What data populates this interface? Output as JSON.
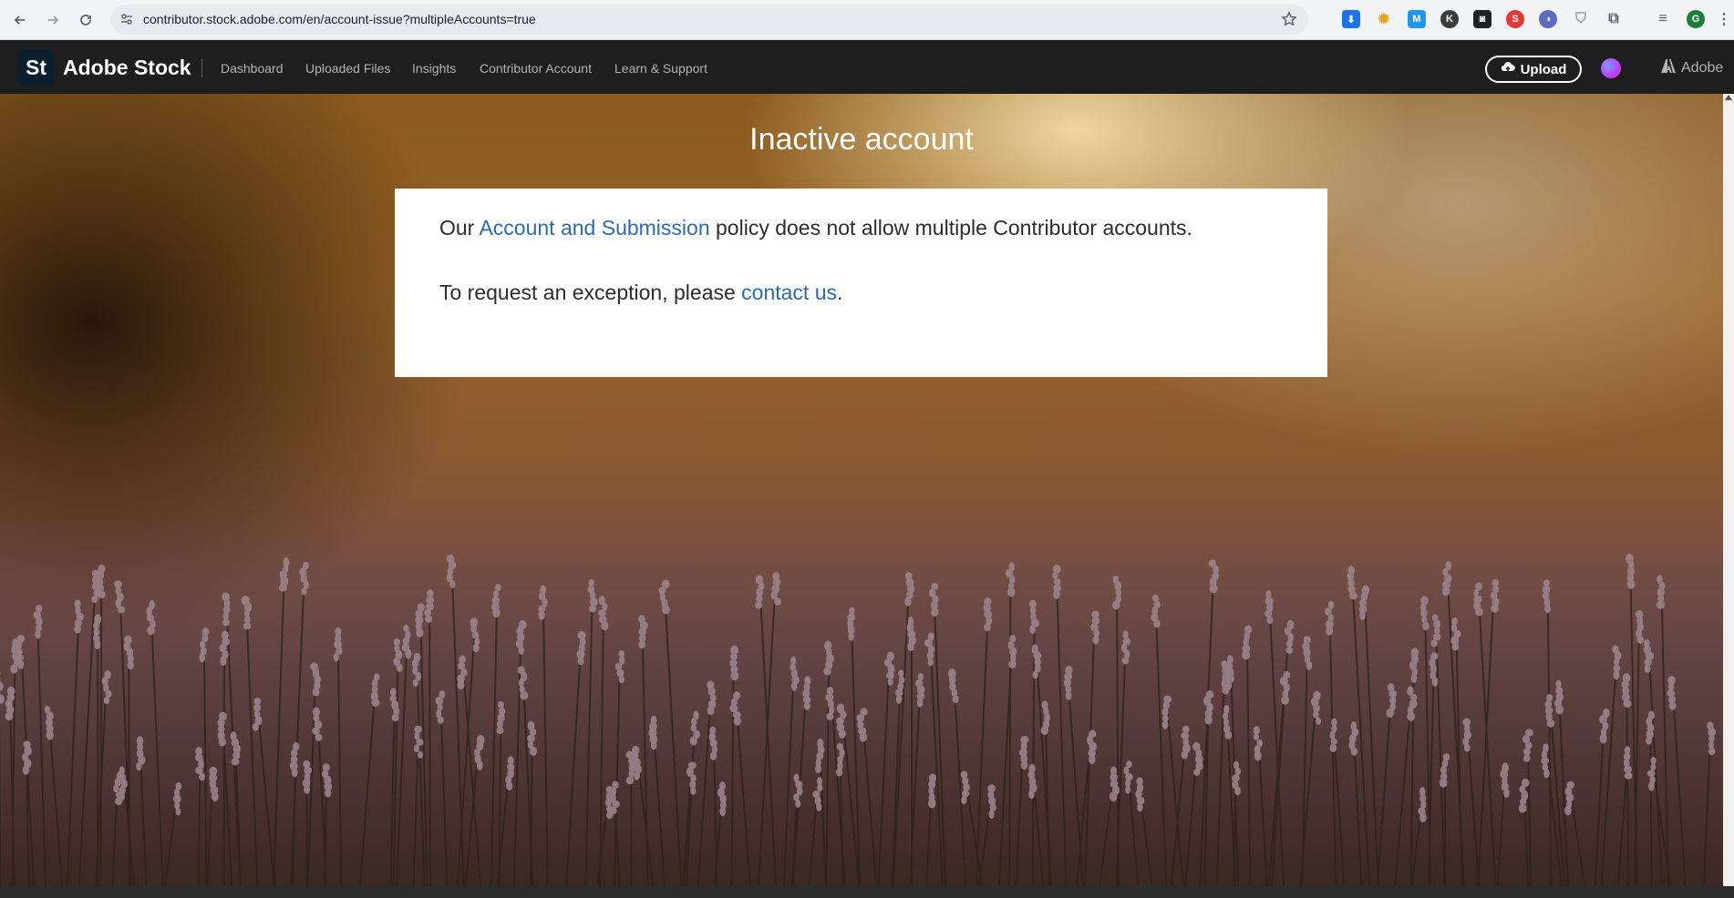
{
  "browser": {
    "url": "contributor.stock.adobe.com/en/account-issue?multipleAccounts=true",
    "profile_initial": "G"
  },
  "header": {
    "logo_text": "St",
    "brand": "Adobe Stock",
    "nav": [
      "Dashboard",
      "Uploaded Files",
      "Insights",
      "Contributor Account",
      "Learn & Support"
    ],
    "upload_label": "Upload",
    "adobe_label": "Adobe"
  },
  "main": {
    "title": "Inactive account",
    "line1": {
      "prefix": "Our ",
      "link": "Account and Submission",
      "suffix": " policy does not allow multiple Contributor accounts."
    },
    "line2": {
      "prefix": "To request an exception, please ",
      "link": "contact us",
      "suffix": "."
    }
  },
  "colors": {
    "header_bg": "#1e1e1e",
    "link": "#2a6bb5",
    "card_bg": "#ffffff"
  }
}
